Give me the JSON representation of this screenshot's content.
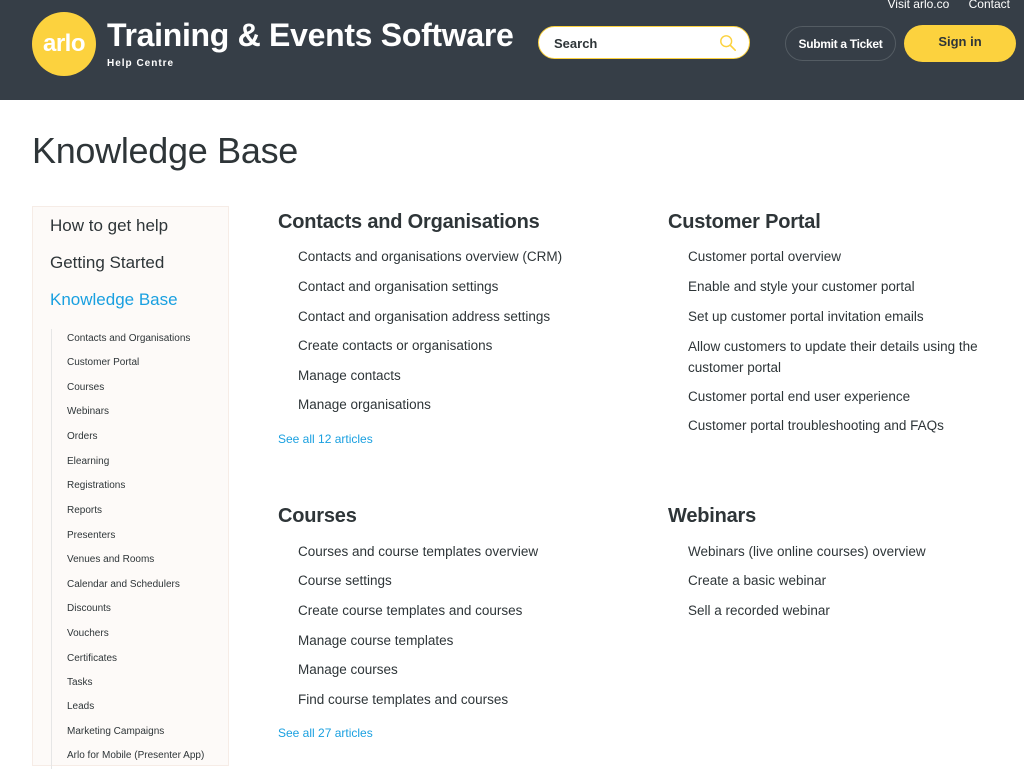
{
  "header": {
    "nav": [
      "Visit arlo.co",
      "Contact"
    ],
    "logo_text": "arlo",
    "title": "Training & Events Software",
    "subtitle": "Help Centre",
    "search_placeholder": "Search",
    "submit_ticket": "Submit a Ticket",
    "sign_in": "Sign in",
    "colors": {
      "header_bg": "#363e47",
      "accent": "#fcd23e",
      "link": "#1aa0e0"
    }
  },
  "page_title": "Knowledge Base",
  "sidebar": {
    "main": [
      {
        "label": "How to get help",
        "active": false
      },
      {
        "label": "Getting Started",
        "active": false
      },
      {
        "label": "Knowledge Base",
        "active": true
      }
    ],
    "sub": [
      "Contacts and Organisations",
      "Customer Portal",
      "Courses",
      "Webinars",
      "Orders",
      "Elearning",
      "Registrations",
      "Reports",
      "Presenters",
      "Venues and Rooms",
      "Calendar and Schedulers",
      "Discounts",
      "Vouchers",
      "Certificates",
      "Tasks",
      "Leads",
      "Marketing Campaigns",
      "Arlo for Mobile (Presenter App)"
    ]
  },
  "categories": [
    {
      "title": "Contacts and Organisations",
      "articles": [
        "Contacts and organisations overview (CRM)",
        "Contact and organisation settings",
        "Contact and organisation address settings",
        "Create contacts or organisations",
        "Manage contacts",
        "Manage organisations"
      ],
      "see_all": "See all 12 articles"
    },
    {
      "title": "Customer Portal",
      "articles": [
        "Customer portal overview",
        "Enable and style your customer portal",
        "Set up customer portal invitation emails",
        "Allow customers to update their details using the customer portal",
        "Customer portal end user experience",
        "Customer portal troubleshooting and FAQs"
      ]
    },
    {
      "title": "Courses",
      "articles": [
        "Courses and course templates overview",
        "Course settings",
        "Create course templates and courses",
        "Manage course templates",
        "Manage courses",
        "Find course templates and courses"
      ],
      "see_all": "See all 27 articles"
    },
    {
      "title": "Webinars",
      "articles": [
        "Webinars (live online courses) overview",
        "Create a basic webinar",
        "Sell a recorded webinar"
      ]
    }
  ]
}
